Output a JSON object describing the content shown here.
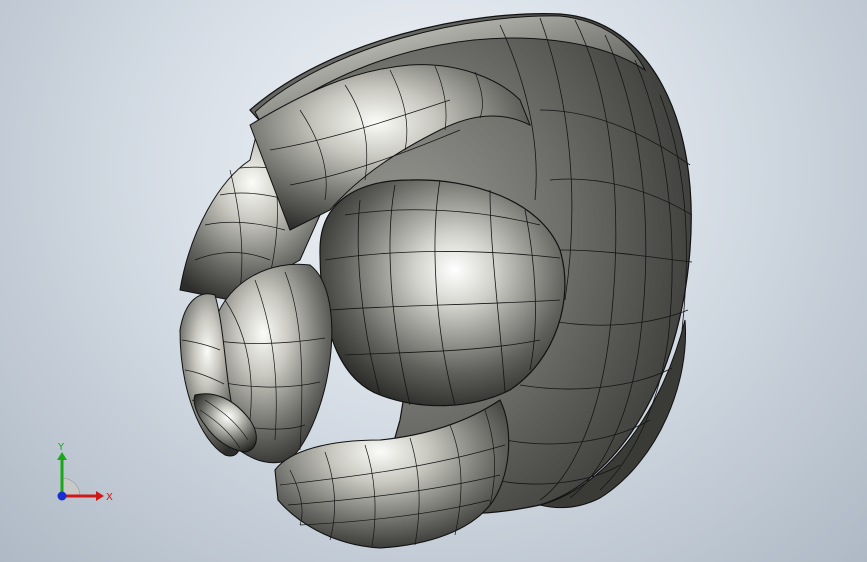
{
  "viewport": {
    "triad": {
      "x_label": "X",
      "y_label": "Y",
      "colors": {
        "x_axis": "#d01818",
        "y_axis": "#18a818",
        "z_axis": "#1830d0"
      }
    }
  }
}
